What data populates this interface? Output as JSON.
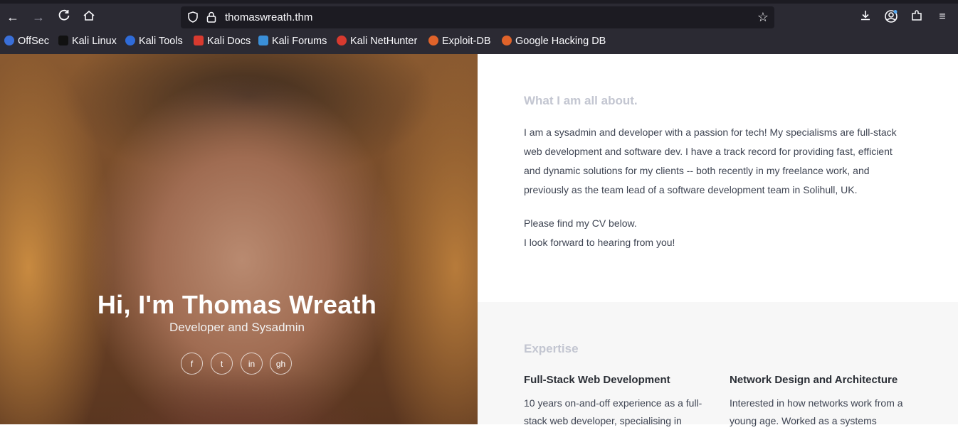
{
  "browser": {
    "url": "thomaswreath.thm",
    "bookmarks": [
      {
        "label": "OffSec",
        "color": "#3a6fd8"
      },
      {
        "label": "Kali Linux",
        "color": "#1b1b1b"
      },
      {
        "label": "Kali Tools",
        "color": "#2f6bd8"
      },
      {
        "label": "Kali Docs",
        "color": "#d83a2f"
      },
      {
        "label": "Kali Forums",
        "color": "#3a8fd8"
      },
      {
        "label": "Kali NetHunter",
        "color": "#d83a2f"
      },
      {
        "label": "Exploit-DB",
        "color": "#e0632a"
      },
      {
        "label": "Google Hacking DB",
        "color": "#e0632a"
      }
    ]
  },
  "hero": {
    "title": "Hi, I'm Thomas Wreath",
    "subtitle": "Developer and Sysadmin",
    "social": [
      "f",
      "t",
      "in",
      "gh"
    ]
  },
  "about": {
    "heading": "What I am all about.",
    "paragraph1_lines": [
      "I am a sysadmin and developer with a passion for tech! My specialisms are full-stack",
      "web development and software dev. I have a track record for providing fast, efficient",
      "and dynamic solutions for my clients -- both recently in my freelance work, and",
      "previously as the team lead of a software development team in Solihull, UK."
    ],
    "paragraph2_lines": [
      "Please find my CV below.",
      "I look forward to hearing from you!"
    ]
  },
  "expertise": {
    "heading": "Expertise",
    "items": [
      {
        "title": "Full-Stack Web Development",
        "lines": [
          "10 years on-and-off experience as a full-",
          "stack web developer, specialising in"
        ]
      },
      {
        "title": "Network Design and Architecture",
        "lines": [
          "Interested in how networks work from a",
          "young age. Worked as a systems"
        ]
      }
    ]
  }
}
